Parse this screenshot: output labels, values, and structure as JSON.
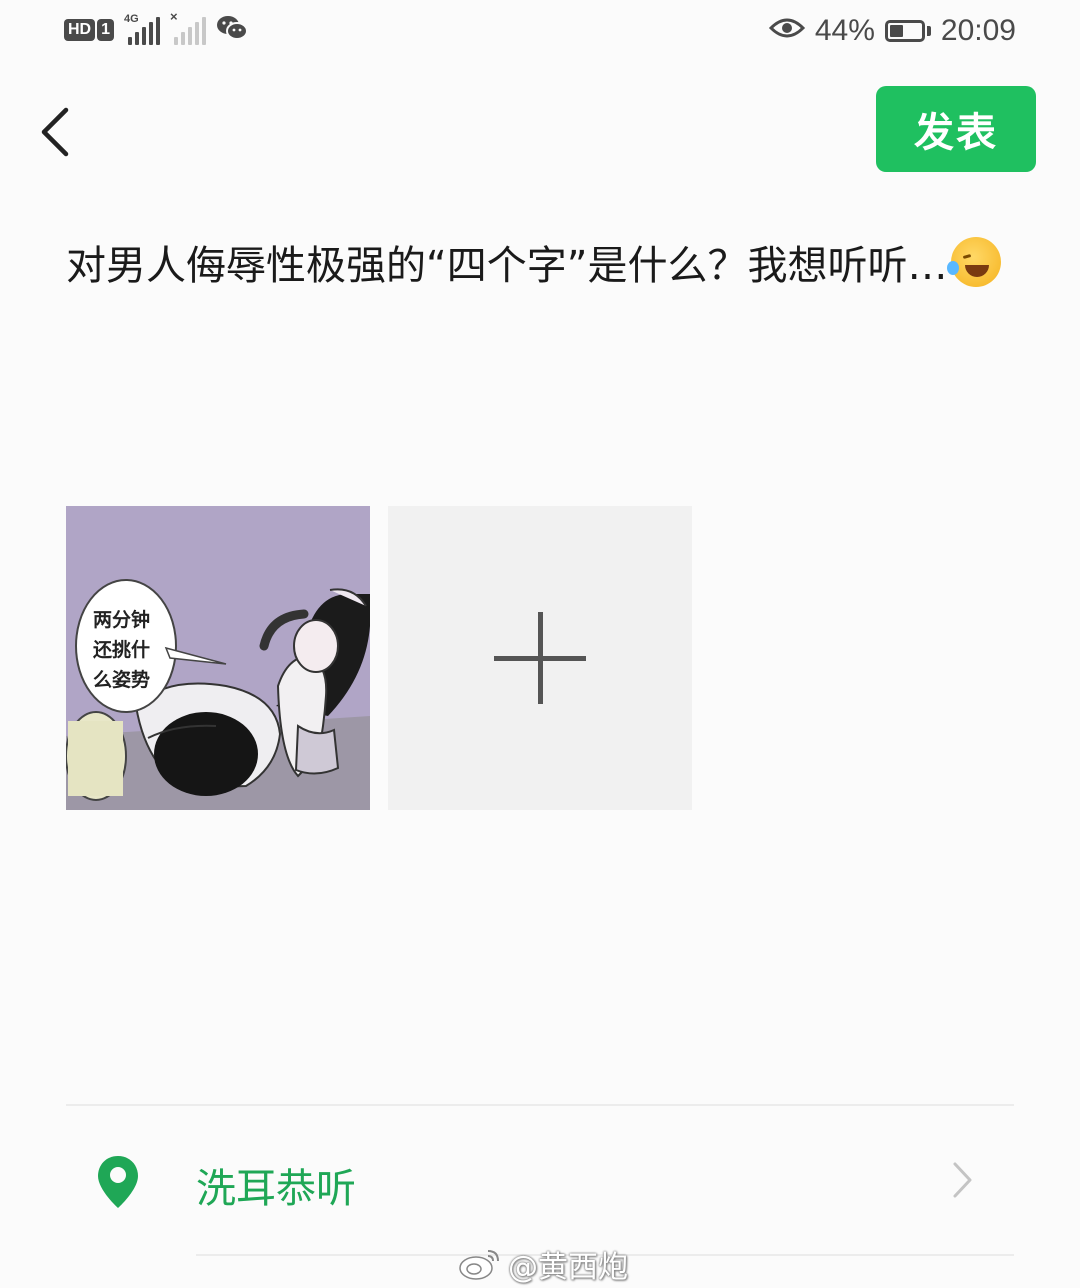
{
  "status_bar": {
    "hd_label": "HD",
    "sim_label": "1",
    "network_label": "4G",
    "battery_percent": "44%",
    "battery_level": 0.44,
    "time": "20:09"
  },
  "header": {
    "publish_label": "发表"
  },
  "post": {
    "text": "对男人侮辱性极强的“四个字”是什么？我想听听…"
  },
  "media": {
    "thumbnail_bubble": "两分钟\n还挑什\n么姿势"
  },
  "location": {
    "label": "洗耳恭听"
  },
  "watermark": {
    "text": "@黄西炮"
  },
  "colors": {
    "accent_green": "#1fc060",
    "location_green": "#1fa756"
  },
  "icons": [
    "back-arrow-icon",
    "plus-icon",
    "location-pin-icon",
    "chevron-right-icon",
    "eye-icon",
    "wechat-icon",
    "weibo-icon",
    "laughing-crying-emoji"
  ]
}
